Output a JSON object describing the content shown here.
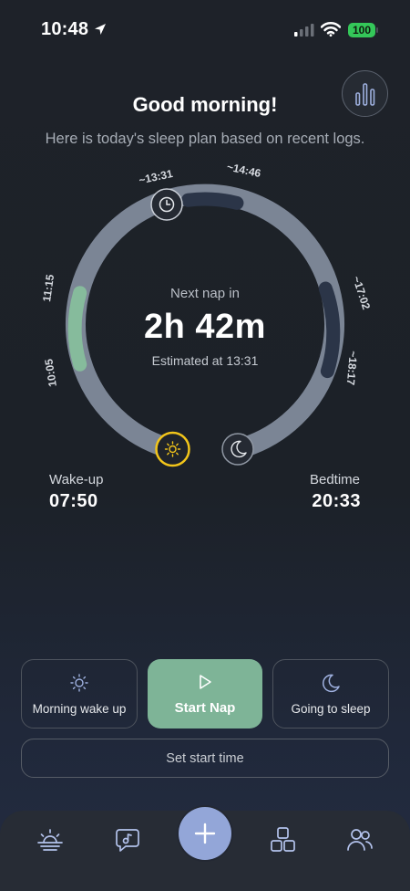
{
  "status_bar": {
    "time": "10:48",
    "battery": "100",
    "icons": [
      "location-arrow-icon",
      "signal-icon",
      "wifi-icon",
      "battery-icon"
    ]
  },
  "header": {
    "greeting": "Good morning!",
    "subtitle": "Here is today's sleep plan based on recent logs.",
    "stats_icon": "bar-chart-icon"
  },
  "ring": {
    "label_1315": "~13:31",
    "label_1446": "~14:46",
    "label_1702": "~17:02",
    "label_1817": "~18:17",
    "label_1115": "11:15",
    "label_1005": "10:05",
    "colors": {
      "track": "#7b8595",
      "past_nap": "#86bb9c",
      "planned_nap": "#2b3548",
      "sun_ring": "#f2c51a"
    }
  },
  "center": {
    "label": "Next nap in",
    "value": "2h 42m",
    "estimate": "Estimated at 13:31"
  },
  "wake": {
    "label": "Wake-up",
    "time": "07:50"
  },
  "bed": {
    "label": "Bedtime",
    "time": "20:33"
  },
  "actions": {
    "morning": "Morning wake up",
    "start": "Start Nap",
    "sleep": "Going to sleep",
    "set_start": "Set start time"
  },
  "tabs": [
    {
      "name": "home",
      "icon": "sunrise-icon",
      "active": true
    },
    {
      "name": "sounds",
      "icon": "music-bubble-icon"
    },
    {
      "name": "add",
      "icon": "plus-icon"
    },
    {
      "name": "modules",
      "icon": "grid-icon"
    },
    {
      "name": "family",
      "icon": "people-icon"
    }
  ]
}
